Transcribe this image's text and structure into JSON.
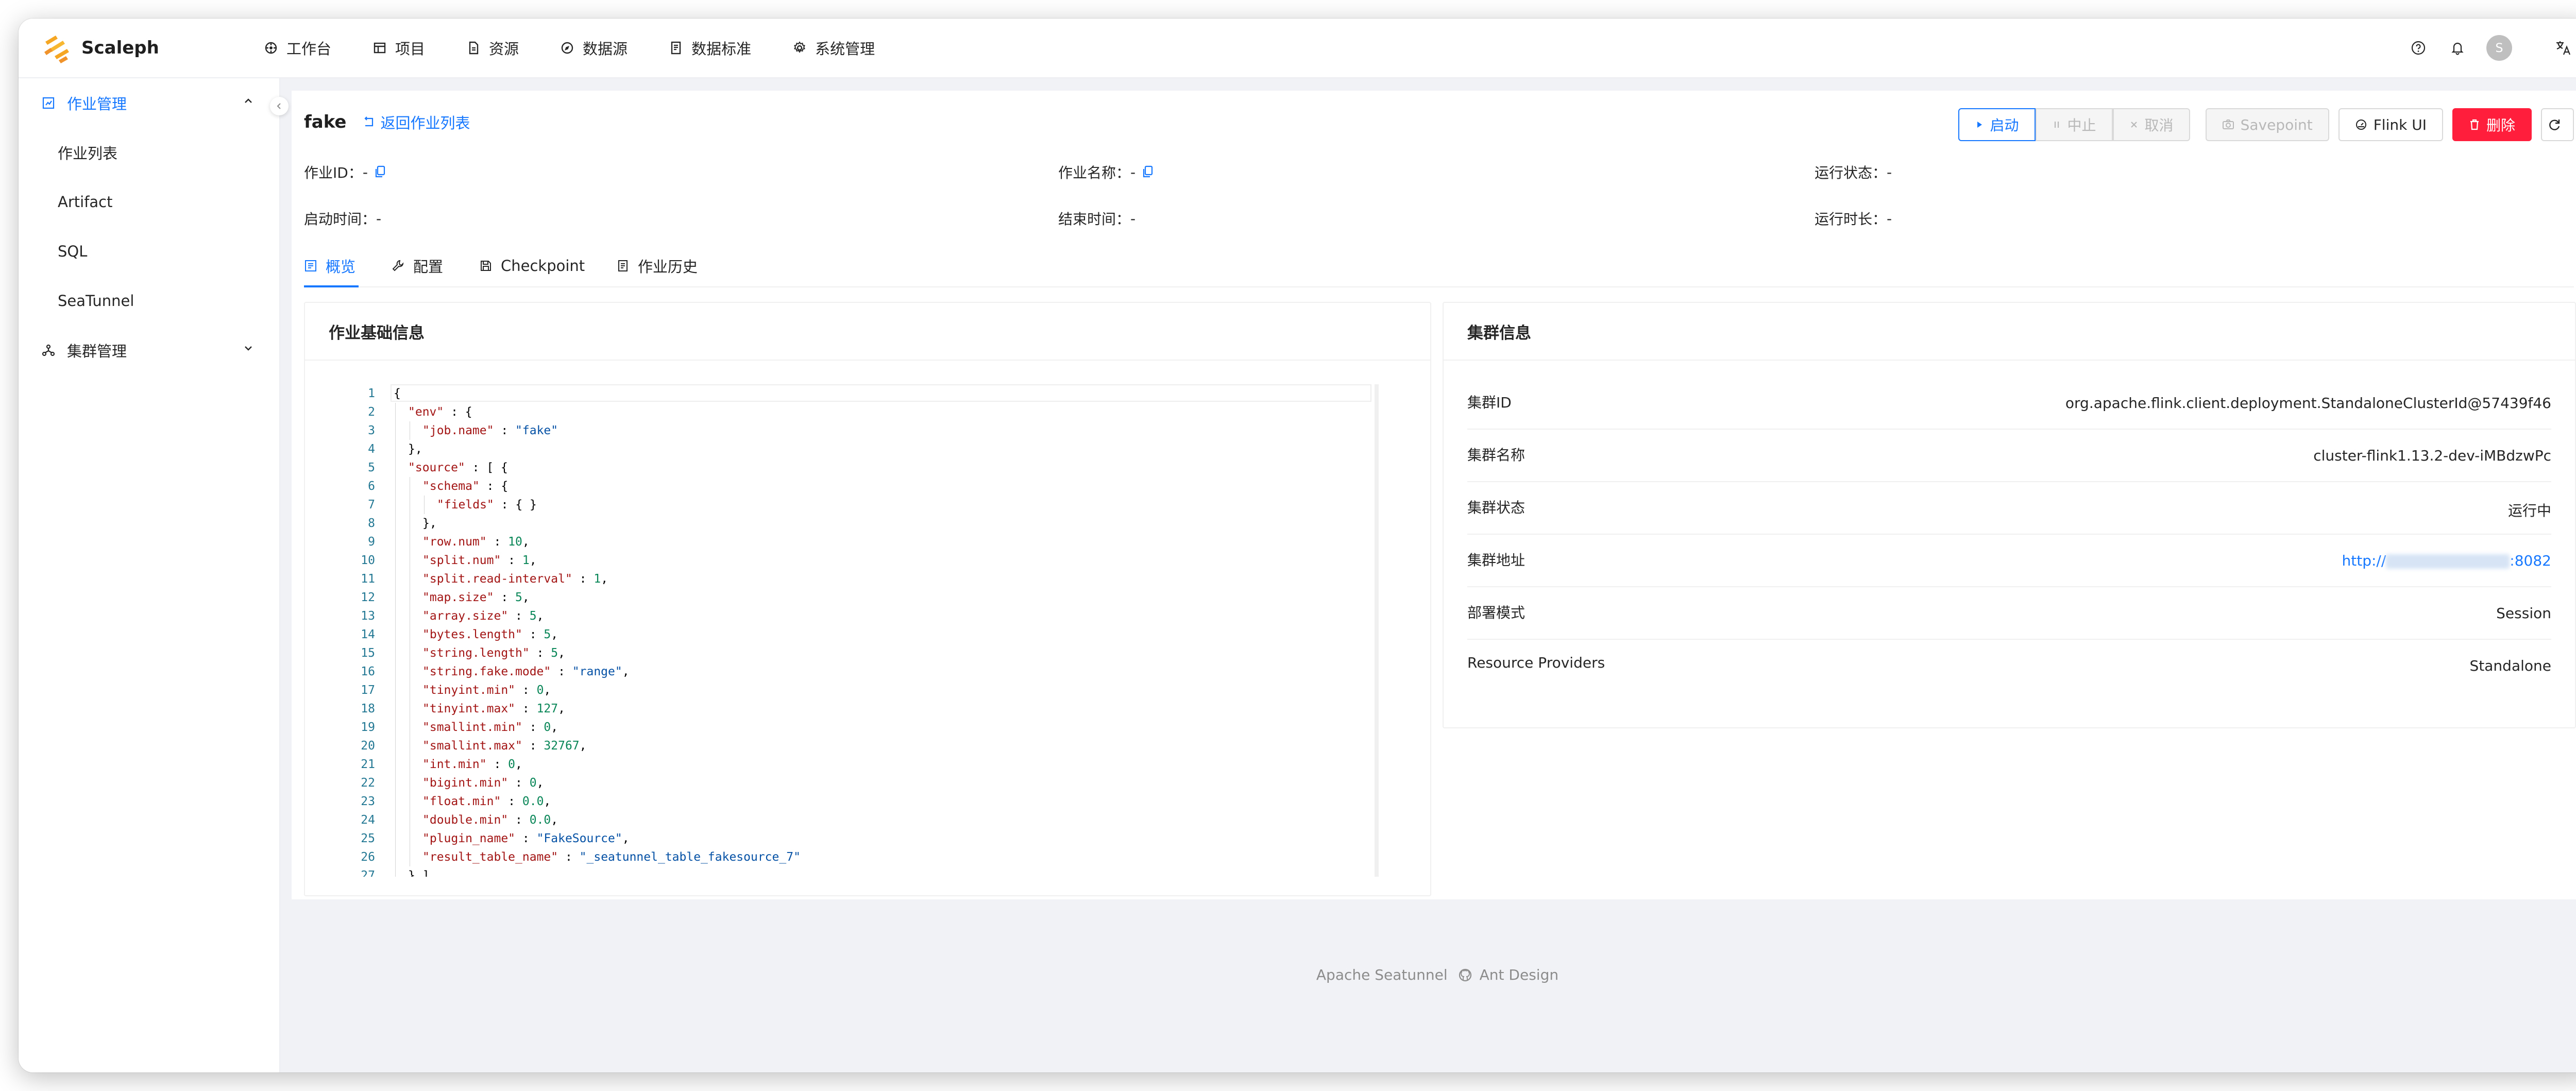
{
  "app": {
    "name": "Scaleph"
  },
  "nav": [
    {
      "label": "工作台",
      "icon": "dashboard-icon"
    },
    {
      "label": "项目",
      "icon": "project-icon"
    },
    {
      "label": "资源",
      "icon": "file-icon"
    },
    {
      "label": "数据源",
      "icon": "compass-icon"
    },
    {
      "label": "数据标准",
      "icon": "book-icon"
    },
    {
      "label": "系统管理",
      "icon": "gear-icon"
    }
  ],
  "user": {
    "avatar_text": "S"
  },
  "sidebar": {
    "groups": [
      {
        "label": "作业管理",
        "expanded": true
      },
      {
        "label": "集群管理",
        "expanded": false
      }
    ],
    "items": [
      "作业列表",
      "Artifact",
      "SQL",
      "SeaTunnel"
    ]
  },
  "job": {
    "name": "fake",
    "back_label": "返回作业列表",
    "fields": {
      "job_id_label": "作业ID：",
      "job_id_value": "-",
      "job_name_label": "作业名称：",
      "job_name_value": "-",
      "run_state_label": "运行状态：",
      "run_state_value": "-",
      "start_label": "启动时间：",
      "start_value": "-",
      "end_label": "结束时间：",
      "end_value": "-",
      "duration_label": "运行时长：",
      "duration_value": "-"
    }
  },
  "actions": {
    "start": "启动",
    "stop": "中止",
    "cancel": "取消",
    "savepoint": "Savepoint",
    "flink_ui": "Flink UI",
    "delete": "删除"
  },
  "tabs": [
    {
      "label": "概览",
      "active": true
    },
    {
      "label": "配置",
      "active": false
    },
    {
      "label": "Checkpoint",
      "active": false
    },
    {
      "label": "作业历史",
      "active": false
    }
  ],
  "basic_card": {
    "title": "作业基础信息",
    "code_lines": [
      {
        "ln": 1,
        "indent": 0,
        "tokens": [
          [
            "p",
            "{"
          ]
        ]
      },
      {
        "ln": 2,
        "indent": 1,
        "tokens": [
          [
            "k",
            "\"env\""
          ],
          [
            "p",
            " : {"
          ]
        ]
      },
      {
        "ln": 3,
        "indent": 2,
        "tokens": [
          [
            "k",
            "\"job.name\""
          ],
          [
            "p",
            " : "
          ],
          [
            "s",
            "\"fake\""
          ]
        ]
      },
      {
        "ln": 4,
        "indent": 1,
        "tokens": [
          [
            "p",
            "},"
          ]
        ]
      },
      {
        "ln": 5,
        "indent": 1,
        "tokens": [
          [
            "k",
            "\"source\""
          ],
          [
            "p",
            " : [ {"
          ]
        ]
      },
      {
        "ln": 6,
        "indent": 2,
        "tokens": [
          [
            "k",
            "\"schema\""
          ],
          [
            "p",
            " : {"
          ]
        ]
      },
      {
        "ln": 7,
        "indent": 3,
        "tokens": [
          [
            "k",
            "\"fields\""
          ],
          [
            "p",
            " : { }"
          ]
        ]
      },
      {
        "ln": 8,
        "indent": 2,
        "tokens": [
          [
            "p",
            "},"
          ]
        ]
      },
      {
        "ln": 9,
        "indent": 2,
        "tokens": [
          [
            "k",
            "\"row.num\""
          ],
          [
            "p",
            " : "
          ],
          [
            "n",
            "10"
          ],
          [
            "p",
            ","
          ]
        ]
      },
      {
        "ln": 10,
        "indent": 2,
        "tokens": [
          [
            "k",
            "\"split.num\""
          ],
          [
            "p",
            " : "
          ],
          [
            "n",
            "1"
          ],
          [
            "p",
            ","
          ]
        ]
      },
      {
        "ln": 11,
        "indent": 2,
        "tokens": [
          [
            "k",
            "\"split.read-interval\""
          ],
          [
            "p",
            " : "
          ],
          [
            "n",
            "1"
          ],
          [
            "p",
            ","
          ]
        ]
      },
      {
        "ln": 12,
        "indent": 2,
        "tokens": [
          [
            "k",
            "\"map.size\""
          ],
          [
            "p",
            " : "
          ],
          [
            "n",
            "5"
          ],
          [
            "p",
            ","
          ]
        ]
      },
      {
        "ln": 13,
        "indent": 2,
        "tokens": [
          [
            "k",
            "\"array.size\""
          ],
          [
            "p",
            " : "
          ],
          [
            "n",
            "5"
          ],
          [
            "p",
            ","
          ]
        ]
      },
      {
        "ln": 14,
        "indent": 2,
        "tokens": [
          [
            "k",
            "\"bytes.length\""
          ],
          [
            "p",
            " : "
          ],
          [
            "n",
            "5"
          ],
          [
            "p",
            ","
          ]
        ]
      },
      {
        "ln": 15,
        "indent": 2,
        "tokens": [
          [
            "k",
            "\"string.length\""
          ],
          [
            "p",
            " : "
          ],
          [
            "n",
            "5"
          ],
          [
            "p",
            ","
          ]
        ]
      },
      {
        "ln": 16,
        "indent": 2,
        "tokens": [
          [
            "k",
            "\"string.fake.mode\""
          ],
          [
            "p",
            " : "
          ],
          [
            "s",
            "\"range\""
          ],
          [
            "p",
            ","
          ]
        ]
      },
      {
        "ln": 17,
        "indent": 2,
        "tokens": [
          [
            "k",
            "\"tinyint.min\""
          ],
          [
            "p",
            " : "
          ],
          [
            "n",
            "0"
          ],
          [
            "p",
            ","
          ]
        ]
      },
      {
        "ln": 18,
        "indent": 2,
        "tokens": [
          [
            "k",
            "\"tinyint.max\""
          ],
          [
            "p",
            " : "
          ],
          [
            "n",
            "127"
          ],
          [
            "p",
            ","
          ]
        ]
      },
      {
        "ln": 19,
        "indent": 2,
        "tokens": [
          [
            "k",
            "\"smallint.min\""
          ],
          [
            "p",
            " : "
          ],
          [
            "n",
            "0"
          ],
          [
            "p",
            ","
          ]
        ]
      },
      {
        "ln": 20,
        "indent": 2,
        "tokens": [
          [
            "k",
            "\"smallint.max\""
          ],
          [
            "p",
            " : "
          ],
          [
            "n",
            "32767"
          ],
          [
            "p",
            ","
          ]
        ]
      },
      {
        "ln": 21,
        "indent": 2,
        "tokens": [
          [
            "k",
            "\"int.min\""
          ],
          [
            "p",
            " : "
          ],
          [
            "n",
            "0"
          ],
          [
            "p",
            ","
          ]
        ]
      },
      {
        "ln": 22,
        "indent": 2,
        "tokens": [
          [
            "k",
            "\"bigint.min\""
          ],
          [
            "p",
            " : "
          ],
          [
            "n",
            "0"
          ],
          [
            "p",
            ","
          ]
        ]
      },
      {
        "ln": 23,
        "indent": 2,
        "tokens": [
          [
            "k",
            "\"float.min\""
          ],
          [
            "p",
            " : "
          ],
          [
            "n",
            "0.0"
          ],
          [
            "p",
            ","
          ]
        ]
      },
      {
        "ln": 24,
        "indent": 2,
        "tokens": [
          [
            "k",
            "\"double.min\""
          ],
          [
            "p",
            " : "
          ],
          [
            "n",
            "0.0"
          ],
          [
            "p",
            ","
          ]
        ]
      },
      {
        "ln": 25,
        "indent": 2,
        "tokens": [
          [
            "k",
            "\"plugin_name\""
          ],
          [
            "p",
            " : "
          ],
          [
            "s",
            "\"FakeSource\""
          ],
          [
            "p",
            ","
          ]
        ]
      },
      {
        "ln": 26,
        "indent": 2,
        "tokens": [
          [
            "k",
            "\"result_table_name\""
          ],
          [
            "p",
            " : "
          ],
          [
            "s",
            "\"_seatunnel_table_fakesource_7\""
          ]
        ]
      },
      {
        "ln": 27,
        "indent": 1,
        "tokens": [
          [
            "p",
            "} ],"
          ]
        ]
      }
    ]
  },
  "cluster_card": {
    "title": "集群信息",
    "rows": [
      {
        "label": "集群ID",
        "value": "org.apache.flink.client.deployment.StandaloneClusterId@57439f46"
      },
      {
        "label": "集群名称",
        "value": "cluster-flink1.13.2-dev-iMBdzwPc"
      },
      {
        "label": "集群状态",
        "value": "运行中"
      },
      {
        "label": "集群地址",
        "value_prefix": "http://",
        "value_suffix": ":8082",
        "link": true
      },
      {
        "label": "部署模式",
        "value": "Session"
      },
      {
        "label": "Resource Providers",
        "value": "Standalone"
      }
    ]
  },
  "footer": {
    "left": "Apache Seatunnel",
    "right": "Ant Design",
    "icon": "github-icon"
  },
  "colors": {
    "primary": "#1677ff",
    "danger": "#ff1f3d",
    "logo": "#f5a623"
  }
}
